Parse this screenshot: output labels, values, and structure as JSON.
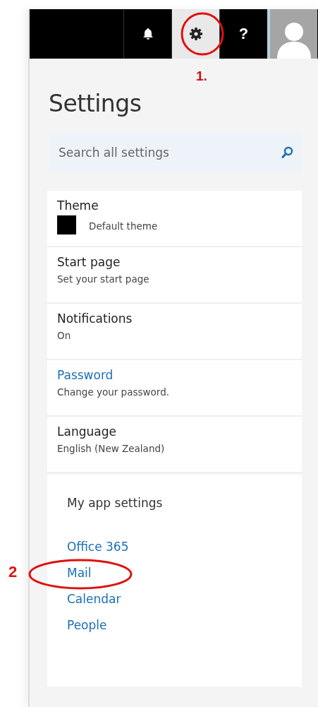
{
  "toolbar": {
    "buttons": [
      {
        "kind": "bell",
        "selected": false
      },
      {
        "kind": "gear",
        "selected": true,
        "annotation": "1."
      },
      {
        "kind": "help",
        "label": "?",
        "selected": false
      },
      {
        "kind": "avatar",
        "selected": false
      }
    ]
  },
  "settings": {
    "title": "Settings",
    "search": {
      "placeholder": "Search all settings"
    },
    "items": [
      {
        "kind": "swatch",
        "title": "Theme",
        "subtitle": "Default theme"
      },
      {
        "kind": "plain",
        "title": "Start page",
        "subtitle": "Set your start page"
      },
      {
        "kind": "plain",
        "title": "Notifications",
        "subtitle": "On"
      },
      {
        "kind": "link",
        "title": "Password",
        "subtitle": "Change your password."
      },
      {
        "kind": "plain",
        "title": "Language",
        "subtitle": "English (New Zealand)"
      }
    ]
  },
  "app_settings": {
    "heading": "My app settings",
    "links": [
      {
        "label": "Office 365"
      },
      {
        "label": "Mail",
        "annotation": "2"
      },
      {
        "label": "Calendar"
      },
      {
        "label": "People"
      }
    ]
  }
}
